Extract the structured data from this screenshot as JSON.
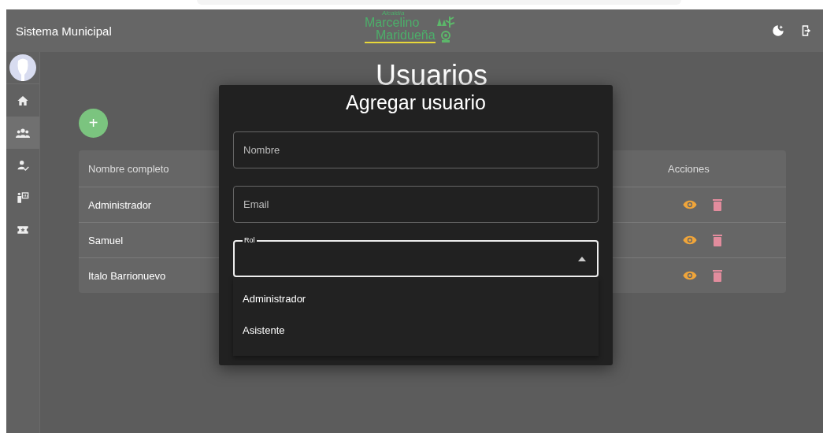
{
  "header": {
    "title": "Sistema Municipal",
    "logo": {
      "top": "Alcaldía",
      "line1": "Marcelino",
      "line2": "Maridueña"
    }
  },
  "sidebar": {
    "items": [
      {
        "kind": "home",
        "selected": false
      },
      {
        "kind": "users",
        "selected": true
      },
      {
        "kind": "user-check",
        "selected": false
      },
      {
        "kind": "presenter",
        "selected": false
      },
      {
        "kind": "ticket",
        "selected": false
      }
    ]
  },
  "page": {
    "title": "Usuarios",
    "add_button": "+"
  },
  "table": {
    "columns": [
      "Nombre completo",
      "Acciones"
    ],
    "rows": [
      {
        "name": "Administrador"
      },
      {
        "name": "Samuel"
      },
      {
        "name": "Italo Barrionuevo"
      }
    ]
  },
  "dialog": {
    "title": "Agregar usuario",
    "fields": [
      {
        "kind": "text",
        "placeholder": "Nombre"
      },
      {
        "kind": "text",
        "placeholder": "Email"
      },
      {
        "kind": "select",
        "label": "Rol",
        "expanded": true,
        "options": [
          "Administrador",
          "Asistente"
        ]
      }
    ]
  }
}
